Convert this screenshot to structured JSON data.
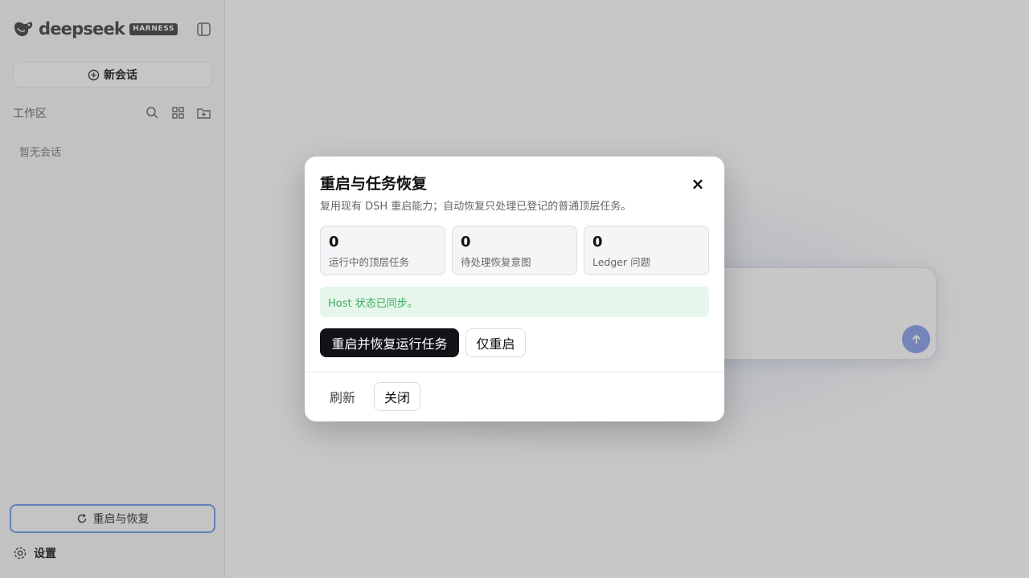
{
  "sidebar": {
    "brand_name": "deepseek",
    "brand_badge": "HARNESS",
    "new_chat_label": "新会话",
    "workspace_label": "工作区",
    "empty_label": "暂无会话",
    "restart_label": "重启与恢复",
    "settings_label": "设置",
    "icons": [
      "logo-icon",
      "collapse-sidebar-icon",
      "plus-circle-icon",
      "search-icon",
      "grid-icon",
      "new-folder-icon",
      "refresh-icon",
      "gear-icon"
    ]
  },
  "main": {
    "send_icon": "arrow-up-icon"
  },
  "modal": {
    "title": "重启与任务恢复",
    "description": "复用现有 DSH 重启能力；自动恢复只处理已登记的普通顶层任务。",
    "close_icon": "close-icon",
    "stats": [
      {
        "value": "0",
        "label": "运行中的顶层任务"
      },
      {
        "value": "0",
        "label": "待处理恢复意图"
      },
      {
        "value": "0",
        "label": "Ledger 问题"
      }
    ],
    "status_text": "Host 状态已同步。",
    "restart_resume_label": "重启并恢复运行任务",
    "restart_only_label": "仅重启",
    "refresh_label": "刷新",
    "close_label": "关闭"
  },
  "colors": {
    "primary_button": "#111318",
    "status_bg": "#e6f6ea",
    "status_text": "#3aaa60",
    "send_button": "#97a9ef",
    "focus_ring": "#7da7ee"
  }
}
